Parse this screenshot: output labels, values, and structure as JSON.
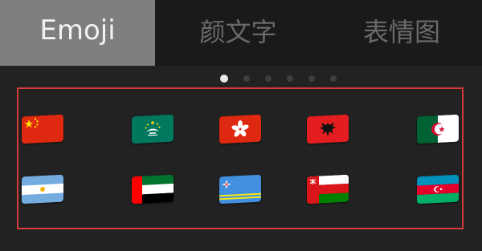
{
  "tabs": [
    {
      "label": "Emoji",
      "active": true
    },
    {
      "label": "颜文字",
      "active": false
    },
    {
      "label": "表情图",
      "active": false
    }
  ],
  "pager": {
    "pages": 6,
    "current": 1
  },
  "flags": [
    {
      "icon": "flag-china-icon"
    },
    {
      "icon": "flag-macau-icon"
    },
    {
      "icon": "flag-hong-kong-icon"
    },
    {
      "icon": "flag-albania-icon"
    },
    {
      "icon": "flag-algeria-icon"
    },
    {
      "icon": "flag-argentina-icon"
    },
    {
      "icon": "flag-united-arab-emirates-icon"
    },
    {
      "icon": "flag-aruba-icon"
    },
    {
      "icon": "flag-oman-icon"
    },
    {
      "icon": "flag-azerbaijan-icon"
    }
  ],
  "colors": {
    "highlight_border": "#d83a3a",
    "active_tab_bg": "#7f7f7f",
    "inactive_tab_text": "#6a6a6a"
  }
}
